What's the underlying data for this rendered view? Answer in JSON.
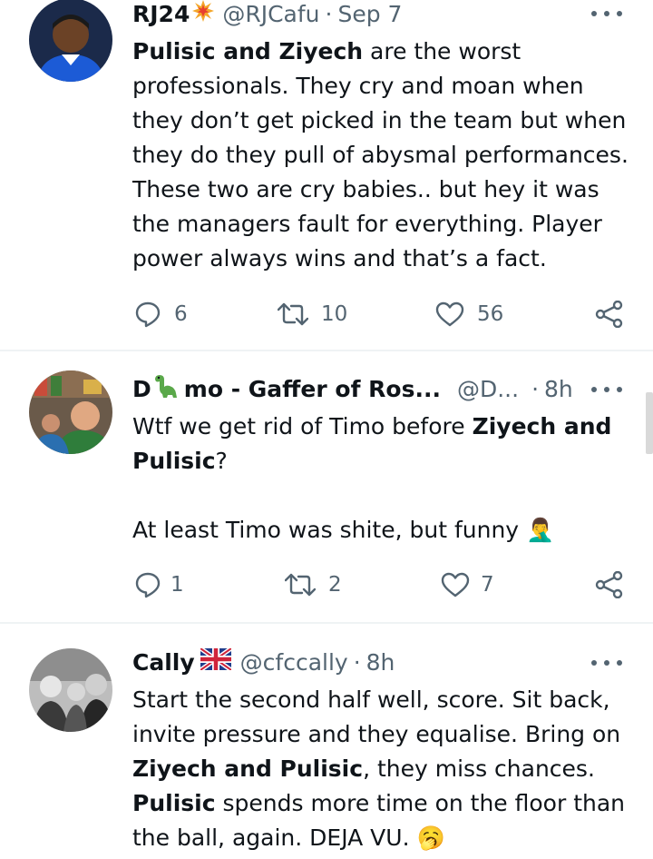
{
  "tweets": [
    {
      "name": "RJ24",
      "handle": "@RJCafu",
      "time": "Sep 7",
      "text_html": "<b>Pulisic and Ziyech</b> are the worst professionals. They cry and moan when they don’t get picked in the team but when they do they pull of abysmal performances. These two are cry babies.. but hey it was the managers fault for everything. Player power always wins and that’s a fact.",
      "replies": "6",
      "retweets": "10",
      "likes": "56"
    },
    {
      "name_prefix": "D",
      "name_suffix": "mo - Gaffer of Ros...",
      "handle": "@D...",
      "time": "8h",
      "text_html": "<span class=\"para\">Wtf we get rid of Timo before <b>Ziyech and Pulisic</b>?</span><span class=\"para\">&nbsp;</span><span class=\"para\">At least Timo was shite, but funny <span data-name=\"facepalm-emoji\" data-interactable=\"false\">🤦‍♂️</span></span>",
      "replies": "1",
      "retweets": "2",
      "likes": "7"
    },
    {
      "name": "Cally",
      "handle": "@cfccally",
      "time": "8h",
      "text_html": "Start the second half well, score. Sit back, invite pressure and they equalise. Bring on <b>Ziyech and Pulisic</b>, they miss chances. <b>Pulisic</b> spends more time on the floor than the ball, again. DEJA VU. <span data-name=\"yawn-emoji\" data-interactable=\"false\">🥱</span>"
    }
  ],
  "separator": "·",
  "icons": {
    "reply": "reply-icon",
    "retweet": "retweet-icon",
    "like": "like-icon",
    "share": "share-icon",
    "more": "more-icon"
  },
  "colors": {
    "text": "#0f1419",
    "secondary": "#536471",
    "divider": "#eff3f4"
  }
}
